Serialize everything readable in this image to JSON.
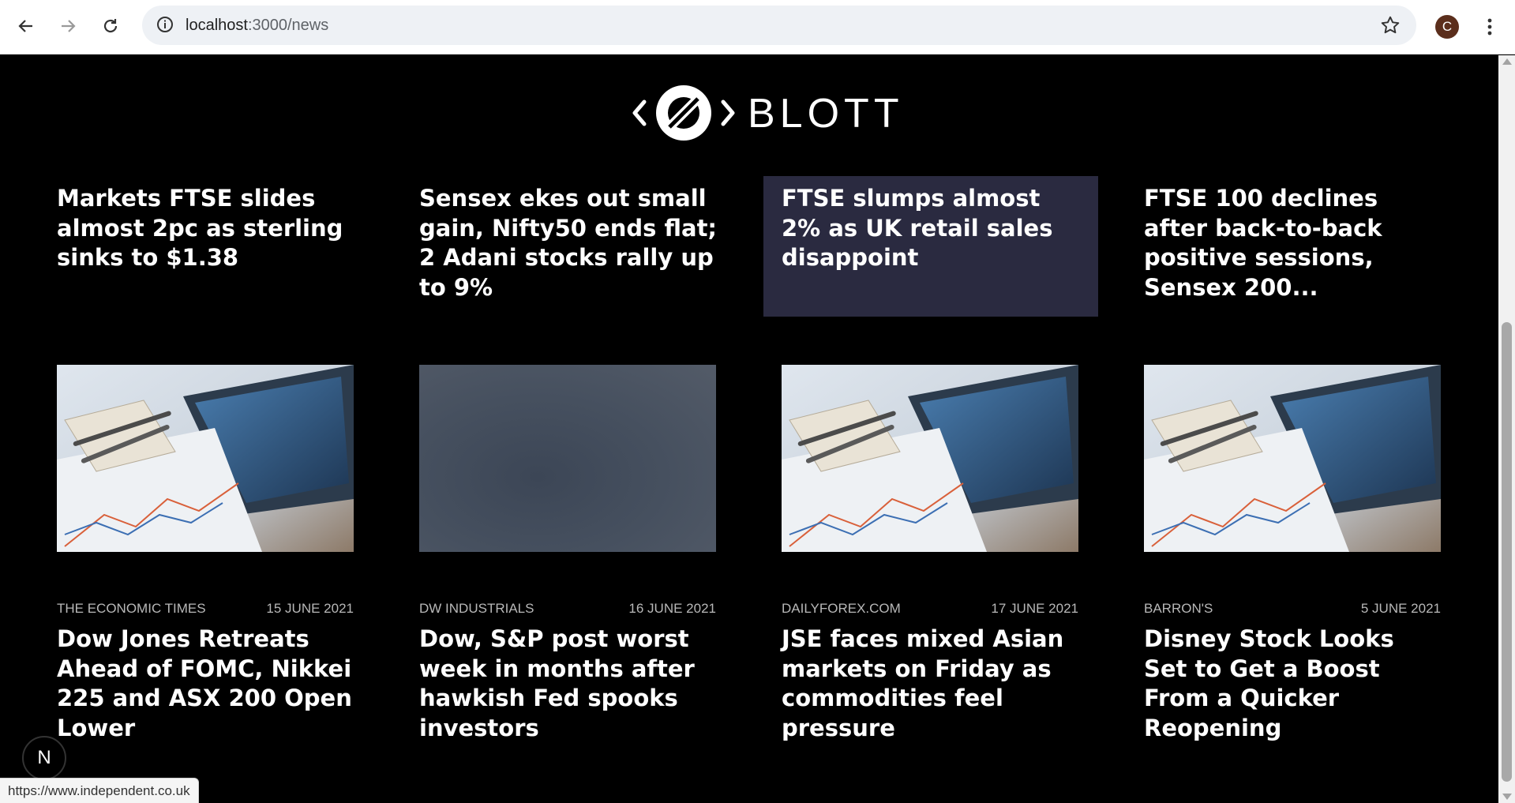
{
  "browser": {
    "url_host": "localhost",
    "url_path": ":3000/news",
    "avatar_letter": "C",
    "status_url": "https://www.independent.co.uk"
  },
  "logo": {
    "text": "BLOTT"
  },
  "top_stories": [
    {
      "headline": "Markets FTSE slides almost 2pc as sterling sinks to $1.38"
    },
    {
      "headline": "Sensex ekes out small gain, Nifty50 ends flat; 2 Adani stocks rally up to 9%"
    },
    {
      "headline": "FTSE slumps almost 2% as UK retail sales disappoint"
    },
    {
      "headline": "FTSE 100 declines after back-to-back positive sessions, Sensex 200..."
    }
  ],
  "articles": [
    {
      "source": "THE ECONOMIC TIMES",
      "date": "15 JUNE 2021",
      "headline": "Dow Jones Retreats Ahead of FOMC, Nikkei 225 and ASX 200 Open Lower",
      "image": "finance-chart-photo"
    },
    {
      "source": "DW INDUSTRIALS",
      "date": "16 JUNE 2021",
      "headline": "Dow, S&P post worst week in months after hawkish Fed spooks investors",
      "image": "blurred-placeholder"
    },
    {
      "source": "DAILYFOREX.COM",
      "date": "17 JUNE 2021",
      "headline": "JSE faces mixed Asian markets on Friday as commodities feel pressure",
      "image": "finance-chart-photo"
    },
    {
      "source": "BARRON'S",
      "date": "5 JUNE 2021",
      "headline": "Disney Stock Looks Set to Get a Boost From a Quicker Reopening",
      "image": "finance-chart-photo"
    }
  ],
  "badge": {
    "letter": "N"
  },
  "colors": {
    "background": "#000000",
    "active_card": "#2a2a40",
    "text": "#ffffff",
    "meta": "#b8b8b8"
  }
}
